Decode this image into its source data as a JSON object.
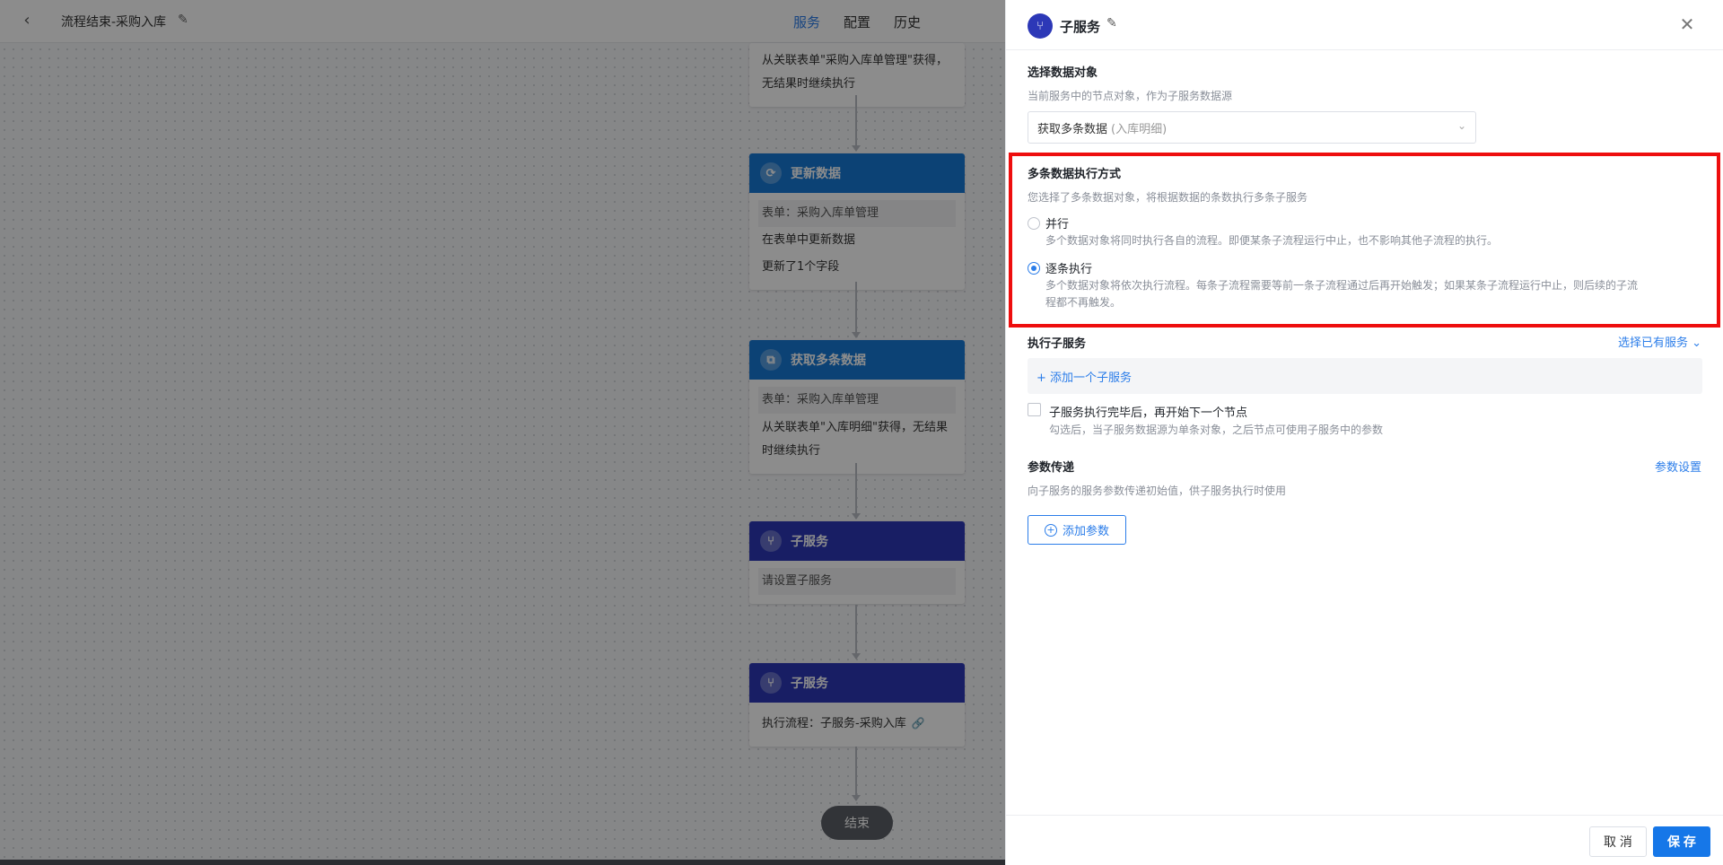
{
  "topbar": {
    "back_icon": "chevron-left-icon",
    "title": "流程结束-采购入库",
    "tabs": [
      {
        "label": "服务",
        "active": true
      },
      {
        "label": "配置",
        "active": false
      },
      {
        "label": "历史",
        "active": false
      }
    ]
  },
  "nodes": {
    "partial": {
      "line1": "从关联表单\"采购入库单管理\"获得，",
      "line2": "无结果时继续执行"
    },
    "update": {
      "title": "更新数据",
      "icon": "refresh-icon",
      "form": "表单：采购入库单管理",
      "line1": "在表单中更新数据",
      "line2": "更新了1个字段"
    },
    "fetch": {
      "title": "获取多条数据",
      "icon": "fetch-icon",
      "form": "表单：采购入库单管理",
      "line1": "从关联表单\"入库明细\"获得，无结果",
      "line2": "时继续执行"
    },
    "sub1": {
      "title": "子服务",
      "icon": "sub-service-icon",
      "body": "请设置子服务"
    },
    "sub2": {
      "title": "子服务",
      "icon": "sub-service-icon",
      "body": "执行流程：子服务-采购入库"
    },
    "end": "结束"
  },
  "drawer": {
    "title": "子服务",
    "select_data": {
      "title": "选择数据对象",
      "hint": "当前服务中的节点对象，作为子服务数据源",
      "value": "获取多条数据",
      "value_sub": "(入库明细)"
    },
    "exec_mode": {
      "title": "多条数据执行方式",
      "hint": "您选择了多条数据对象，将根据数据的条数执行多条子服务",
      "options": [
        {
          "label": "并行",
          "checked": false,
          "desc": "多个数据对象将同时执行各自的流程。即便某条子流程运行中止，也不影响其他子流程的执行。"
        },
        {
          "label": "逐条执行",
          "checked": true,
          "desc1": "多个数据对象将依次执行流程。每条子流程需要等前一条子流程通过后再开始触发；如果某条子流程运行中止，则后续的子流",
          "desc2": "程都不再触发。"
        }
      ]
    },
    "exec_sub": {
      "title": "执行子服务",
      "select_existing": "选择已有服务",
      "add_sub": "+ 添加一个子服务",
      "checkbox_label": "子服务执行完毕后，再开始下一个节点",
      "checkbox_hint": "勾选后，当子服务数据源为单条对象，之后节点可使用子服务中的参数"
    },
    "params": {
      "title": "参数传递",
      "settings_link": "参数设置",
      "hint": "向子服务的服务参数传递初始值，供子服务执行时使用",
      "add_button": "添加参数"
    },
    "footer": {
      "cancel": "取 消",
      "save": "保 存"
    }
  }
}
